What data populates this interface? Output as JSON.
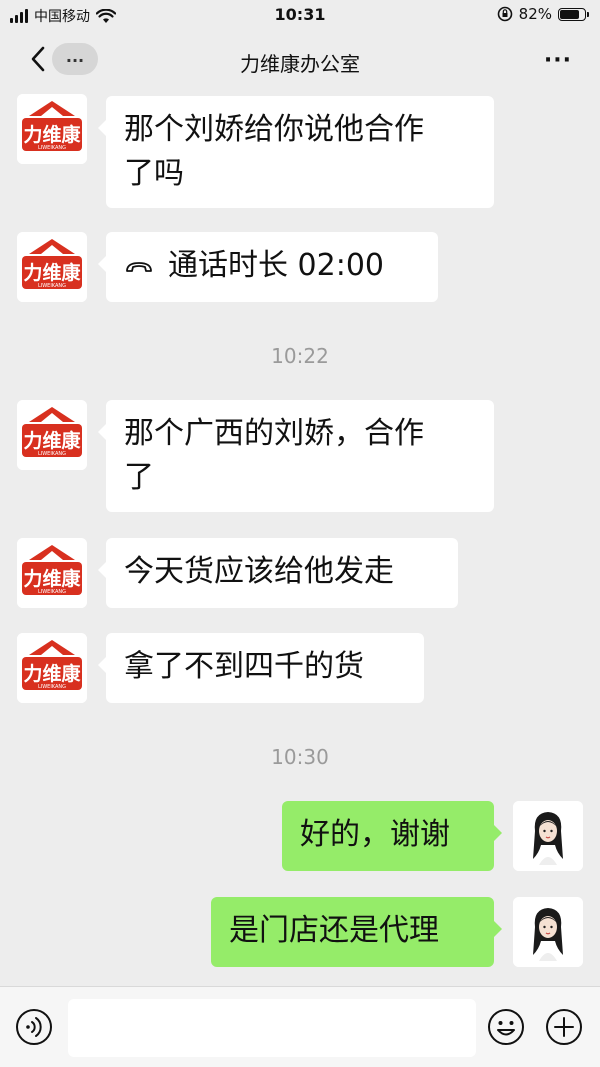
{
  "status_bar": {
    "carrier": "中国移动",
    "time": "10:31",
    "battery": "82%",
    "battery_level": 0.82
  },
  "nav": {
    "title": "力维康办公室",
    "more_label": "..."
  },
  "messages": [
    {
      "text_line1": "那个刘娇给你说他合作",
      "text_line2": "了吗"
    },
    {
      "call_label": "通话时长 02:00"
    },
    {
      "time": "10:22"
    },
    {
      "text_line1": "那个广西的刘娇，合作",
      "text_line2": "了"
    },
    {
      "text": "今天货应该给他发走"
    },
    {
      "text": "拿了不到四千的货"
    },
    {
      "time": "10:30"
    },
    {
      "text": "好的，谢谢"
    },
    {
      "text": "是门店还是代理"
    }
  ],
  "logo": {
    "name": "力维康",
    "subtitle": "LIWEIKANG",
    "color": "#d8301f"
  },
  "input": {
    "placeholder": ""
  },
  "colors": {
    "background": "#ededed",
    "out_bubble": "#95ec69",
    "in_bubble": "#ffffff"
  }
}
